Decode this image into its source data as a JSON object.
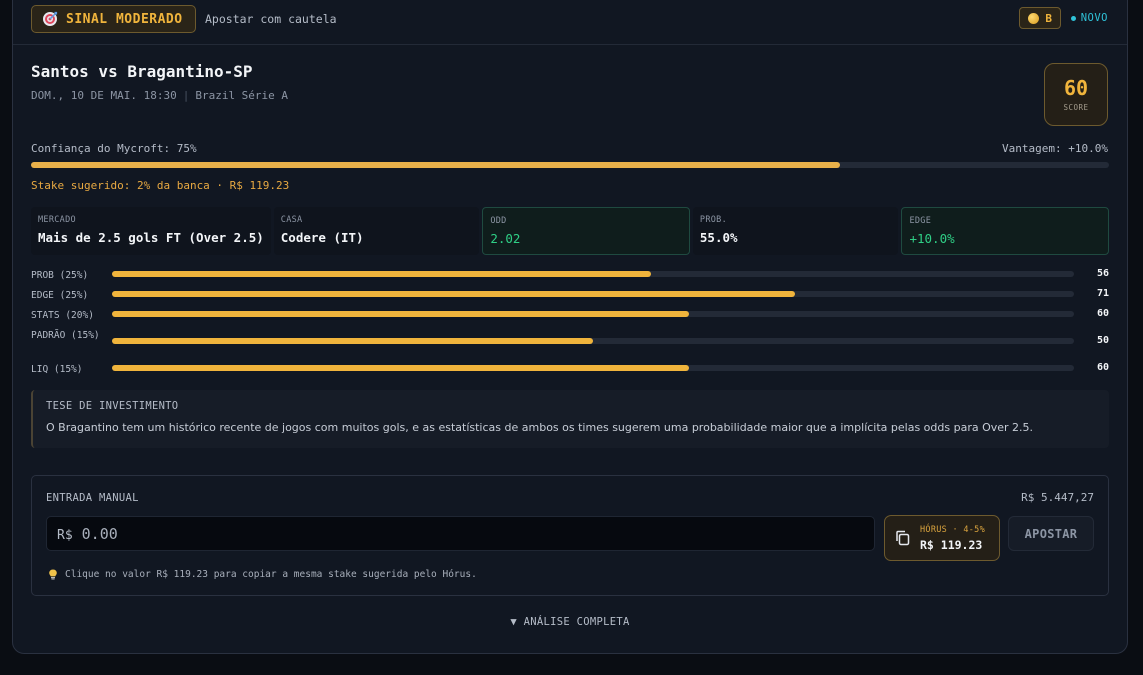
{
  "header": {
    "signal_label": "SINAL MODERADO",
    "signal_subtitle": "Apostar com cautela",
    "grade": "B",
    "new_tag": "NOVO"
  },
  "match": {
    "title": "Santos vs Bragantino-SP",
    "datetime": "DOM., 10 DE MAI. 18:30",
    "separator": "|",
    "competition": "Brazil Série A"
  },
  "score": {
    "value": "60",
    "label": "SCORE"
  },
  "confidence": {
    "label": "Confiança do Mycroft: 75%",
    "value": 75,
    "edge_label": "Vantagem: +10.0%",
    "stake_text": "Stake sugerido: 2% da banca · R$ 119.23"
  },
  "info": [
    {
      "caption": "MERCADO",
      "value": "Mais de 2.5 gols FT (Over 2.5)",
      "highlight": false
    },
    {
      "caption": "CASA",
      "value": "Codere (IT)",
      "highlight": false
    },
    {
      "caption": "ODD",
      "value": "2.02",
      "highlight": true
    },
    {
      "caption": "PROB.",
      "value": "55.0%",
      "highlight": false
    },
    {
      "caption": "EDGE",
      "value": "+10.0%",
      "highlight": true
    }
  ],
  "metrics": [
    {
      "label": "PROB (25%)",
      "value": 56
    },
    {
      "label": "EDGE (25%)",
      "value": 71
    },
    {
      "label": "STATS (20%)",
      "value": 60
    },
    {
      "label": "PADRÃO (15%)",
      "value": 50
    },
    {
      "label": "LIQ (15%)",
      "value": 60
    }
  ],
  "thesis": {
    "title": "TESE DE INVESTIMENTO",
    "text": "O Bragantino tem um histórico recente de jogos com muitos gols, e as estatísticas de ambos os times sugerem uma probabilidade maior que a implícita pelas odds para Over 2.5."
  },
  "manual": {
    "title": "ENTRADA MANUAL",
    "balance": "R$ 5.447,27",
    "currency": "R$",
    "amount_placeholder": "0.00",
    "amount_value": "",
    "horus_caption": "HÓRUS · 4-5%",
    "horus_value": "R$ 119.23",
    "bet_button": "APOSTAR",
    "hint": "Clique no valor R$ 119.23 para copiar a mesma stake sugerida pelo Hórus."
  },
  "expand_label": "▼ ANÁLISE COMPLETA",
  "colors": {
    "accent": "#f0b43c",
    "positive": "#2fcf86",
    "info": "#2fc2d8",
    "background": "#111722"
  }
}
